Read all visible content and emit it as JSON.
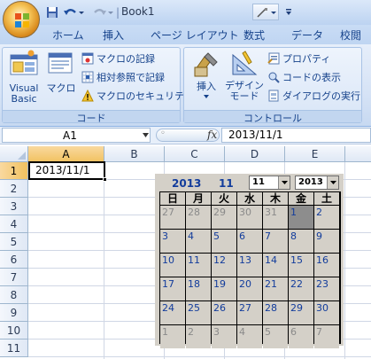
{
  "app": {
    "title": "Book1",
    "quick_access": {
      "save_icon": "save-icon",
      "undo_icon": "undo-icon",
      "redo_icon": "redo-icon",
      "customize_icon": "chevron-down-icon"
    }
  },
  "tabs": [
    "ホーム",
    "挿入",
    "ページ レイアウト",
    "数式",
    "データ",
    "校閲"
  ],
  "ribbon": {
    "code_group": {
      "label": "コード",
      "visual_basic": "Visual Basic",
      "macro": "マクロ",
      "record_macro": "マクロの記録",
      "relative_ref": "相対参照で記録",
      "macro_security": "マクロのセキュリティ"
    },
    "control_group": {
      "label": "コントロール",
      "insert": "挿入",
      "design_mode": "デザイン モード",
      "properties": "プロパティ",
      "view_code": "コードの表示",
      "run_dialog": "ダイアログの実行"
    }
  },
  "formula_bar": {
    "name_box": "A1",
    "fx": "fx",
    "value": "2013/11/1"
  },
  "sheet": {
    "columns": [
      "A",
      "B",
      "C",
      "D",
      "E"
    ],
    "rows": [
      "1",
      "2",
      "3",
      "4",
      "5",
      "6",
      "7",
      "8",
      "9",
      "10",
      "11"
    ],
    "cell_a1": "2013/11/1"
  },
  "calendar": {
    "year": "2013",
    "month": "11",
    "month_select": "11",
    "year_select": "2013",
    "weekdays": [
      "日",
      "月",
      "火",
      "水",
      "木",
      "金",
      "土"
    ],
    "weeks": [
      [
        {
          "d": "27",
          "o": true
        },
        {
          "d": "28",
          "o": true
        },
        {
          "d": "29",
          "o": true
        },
        {
          "d": "30",
          "o": true
        },
        {
          "d": "31",
          "o": true
        },
        {
          "d": "1",
          "o": false,
          "sel": true
        },
        {
          "d": "2",
          "o": false
        }
      ],
      [
        {
          "d": "3",
          "o": false
        },
        {
          "d": "4",
          "o": false
        },
        {
          "d": "5",
          "o": false
        },
        {
          "d": "6",
          "o": false
        },
        {
          "d": "7",
          "o": false
        },
        {
          "d": "8",
          "o": false
        },
        {
          "d": "9",
          "o": false
        }
      ],
      [
        {
          "d": "10",
          "o": false
        },
        {
          "d": "11",
          "o": false
        },
        {
          "d": "12",
          "o": false
        },
        {
          "d": "13",
          "o": false
        },
        {
          "d": "14",
          "o": false
        },
        {
          "d": "15",
          "o": false
        },
        {
          "d": "16",
          "o": false
        }
      ],
      [
        {
          "d": "17",
          "o": false
        },
        {
          "d": "18",
          "o": false
        },
        {
          "d": "19",
          "o": false
        },
        {
          "d": "20",
          "o": false
        },
        {
          "d": "21",
          "o": false
        },
        {
          "d": "22",
          "o": false
        },
        {
          "d": "23",
          "o": false
        }
      ],
      [
        {
          "d": "24",
          "o": false
        },
        {
          "d": "25",
          "o": false
        },
        {
          "d": "26",
          "o": false
        },
        {
          "d": "27",
          "o": false
        },
        {
          "d": "28",
          "o": false
        },
        {
          "d": "29",
          "o": false
        },
        {
          "d": "30",
          "o": false
        }
      ],
      [
        {
          "d": "1",
          "o": true
        },
        {
          "d": "2",
          "o": true
        },
        {
          "d": "3",
          "o": true
        },
        {
          "d": "4",
          "o": true
        },
        {
          "d": "5",
          "o": true
        },
        {
          "d": "6",
          "o": true
        },
        {
          "d": "7",
          "o": true
        }
      ]
    ],
    "colors": {
      "current": "#123c9c",
      "other": "#8a8a8a",
      "selected_bg": "#8d8d8d",
      "header_bg": "#d4d0c8"
    }
  }
}
